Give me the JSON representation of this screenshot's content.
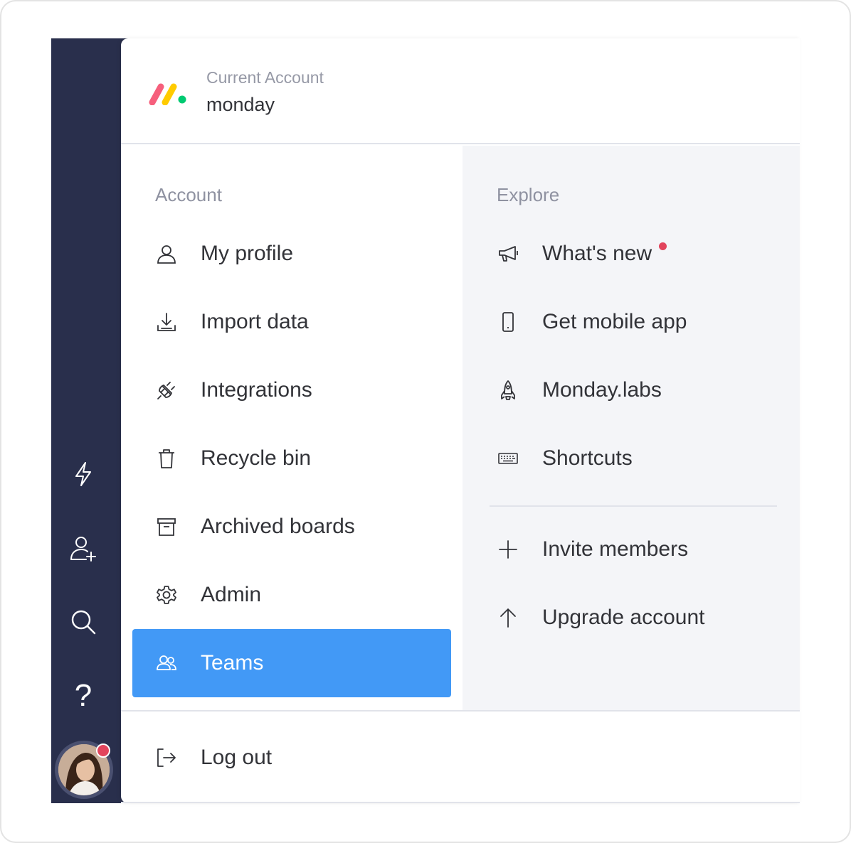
{
  "colors": {
    "rail": "#292f4c",
    "active": "#4299f6",
    "notification": "#e2445c",
    "logo": [
      "#f65f7c",
      "#ffcb00",
      "#00ca72"
    ]
  },
  "rail": {
    "buttons": [
      {
        "icon": "lightning-icon"
      },
      {
        "icon": "add-user-icon"
      },
      {
        "icon": "search-icon"
      },
      {
        "icon": "help-icon",
        "glyph": "?"
      }
    ],
    "avatar": {
      "icon": "avatar",
      "has_notification": true
    }
  },
  "header": {
    "label": "Current Account",
    "account_name": "monday"
  },
  "account": {
    "title": "Account",
    "items": [
      {
        "label": "My profile",
        "icon": "person-icon"
      },
      {
        "label": "Import data",
        "icon": "download-icon"
      },
      {
        "label": "Integrations",
        "icon": "plug-icon"
      },
      {
        "label": "Recycle bin",
        "icon": "trash-icon"
      },
      {
        "label": "Archived boards",
        "icon": "archive-icon"
      },
      {
        "label": "Admin",
        "icon": "gear-icon"
      },
      {
        "label": "Teams",
        "icon": "team-icon",
        "active": true
      }
    ]
  },
  "explore": {
    "title": "Explore",
    "items": [
      {
        "label": "What's new",
        "icon": "megaphone-icon",
        "has_dot": true
      },
      {
        "label": "Get mobile app",
        "icon": "phone-icon"
      },
      {
        "label": "Monday.labs",
        "icon": "rocket-icon"
      },
      {
        "label": "Shortcuts",
        "icon": "keyboard-icon"
      }
    ],
    "actions": [
      {
        "label": "Invite members",
        "icon": "plus-icon"
      },
      {
        "label": "Upgrade account",
        "icon": "arrow-up-icon"
      }
    ]
  },
  "footer": {
    "logout_label": "Log out",
    "logout_icon": "logout-icon"
  }
}
